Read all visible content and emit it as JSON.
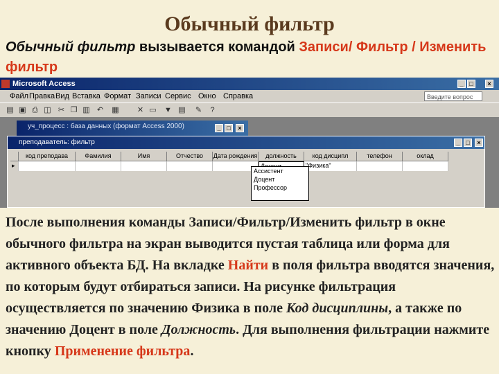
{
  "slide": {
    "title": "Обычный фильтр",
    "intro": {
      "part1": "Обычный фильтр",
      "part2": " вызывается командой ",
      "part3": "Записи/ Фильтр / Изменить фильтр"
    },
    "body": {
      "p1": "После выполнения команды Записи/Фильтр/Изменить фильтр в окне обычного фильтра на экран выводится пустая таблица или форма для активного объекта БД. На вкладке ",
      "p2": "Найти",
      "p3": " в поля фильтра вводятся значения, по которым будут отбираться записи. На рисунке фильтрация осуществляется по значению Физика в поле ",
      "p4": "Код дисциплины",
      "p5": ", а также по значению Доцент в поле ",
      "p6": "Должность",
      "p7": ". Для выполнения фильтрации нажмите кнопку ",
      "p8": "Применение фильтра",
      "p9": "."
    }
  },
  "screenshot": {
    "app_title": "Microsoft Access",
    "menu": [
      "Файл",
      "Правка",
      "Вид",
      "Вставка",
      "Формат",
      "Записи",
      "Сервис",
      "Окно",
      "Справка"
    ],
    "help_placeholder": "Введите вопрос",
    "db_window_title": "уч_процесс : база данных (формат Access 2000)",
    "table_window_title": "преподаватель: фильтр",
    "columns": [
      "код преподава",
      "Фамилия",
      "Имя",
      "Отчество",
      "Дата рождения",
      "должность",
      "код дисципл",
      "телефон",
      "оклад"
    ],
    "cells": [
      "",
      "",
      "",
      "",
      "",
      "Доцент",
      "\"Физика\"",
      "",
      ""
    ],
    "dropdown_options": [
      "Ассистент",
      "Доцент",
      "Профессор"
    ]
  }
}
